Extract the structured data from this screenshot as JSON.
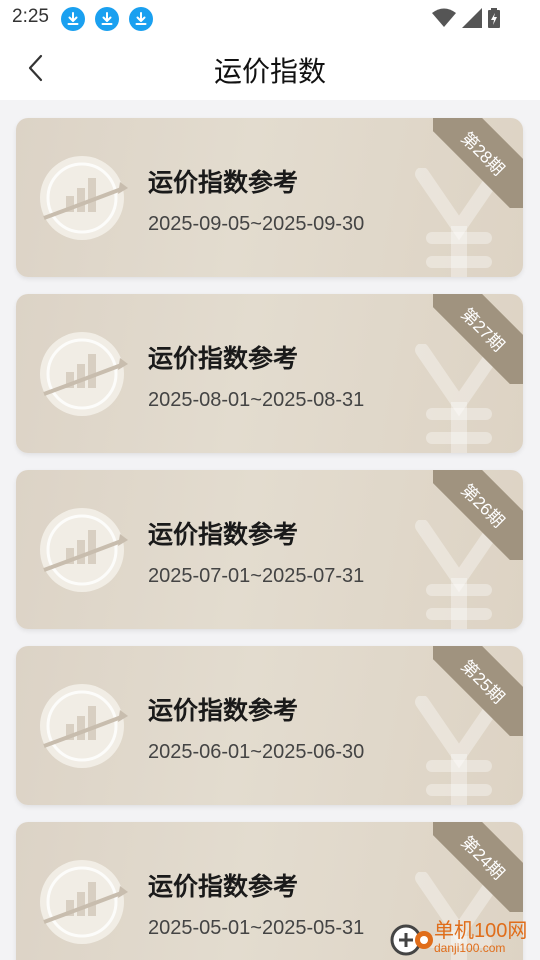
{
  "status": {
    "time": "2:25",
    "download_icons": [
      "download-icon",
      "download-icon",
      "download-icon"
    ],
    "system_icons": [
      "wifi-icon",
      "signal-icon",
      "battery-icon"
    ]
  },
  "nav": {
    "back_icon": "chevron-left-icon",
    "title": "运价指数"
  },
  "cards": [
    {
      "title": "运价指数参考",
      "date_range": "2025-09-05~2025-09-30",
      "issue": "第28期"
    },
    {
      "title": "运价指数参考",
      "date_range": "2025-08-01~2025-08-31",
      "issue": "第27期"
    },
    {
      "title": "运价指数参考",
      "date_range": "2025-07-01~2025-07-31",
      "issue": "第26期"
    },
    {
      "title": "运价指数参考",
      "date_range": "2025-06-01~2025-06-30",
      "issue": "第25期"
    },
    {
      "title": "运价指数参考",
      "date_range": "2025-05-01~2025-05-31",
      "issue": "第24期"
    }
  ],
  "watermark": {
    "text": "单机100网",
    "sub": "danji100.com"
  },
  "colors": {
    "card_bg": "#e0d8cb",
    "ribbon": "#a0937f",
    "download_blue": "#1aa0f0",
    "watermark_orange": "#e06d1a"
  }
}
